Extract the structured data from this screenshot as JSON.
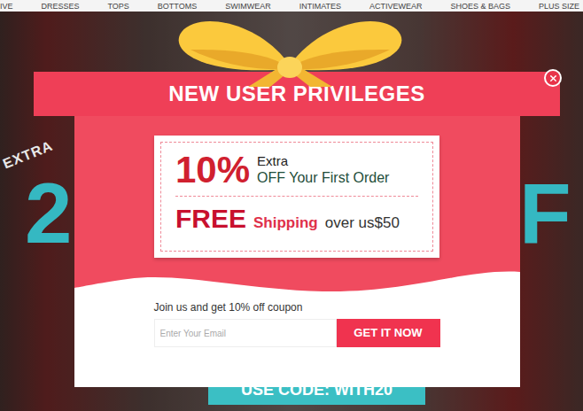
{
  "nav": {
    "items": [
      "IVE",
      "DRESSES",
      "TOPS",
      "BOTTOMS",
      "SWIMWEAR",
      "INTIMATES",
      "ACTIVEWEAR",
      "SHOES & BAGS",
      "PLUS SIZE"
    ]
  },
  "banner": {
    "tag": "EXTRA",
    "left_char": "2",
    "right_char": "F",
    "code": "USE CODE: WITH20"
  },
  "popup": {
    "title": "NEW USER PRIVILEGES",
    "coupon": {
      "discount": "10%",
      "discount_line1": "Extra",
      "discount_line2": "OFF Your First Order",
      "free": "FREE",
      "shipping": "Shipping",
      "threshold": "over us$50"
    },
    "signup": {
      "prompt": "Join us and get 10% off coupon",
      "email_placeholder": "Enter Your Email",
      "button": "GET IT NOW"
    }
  }
}
